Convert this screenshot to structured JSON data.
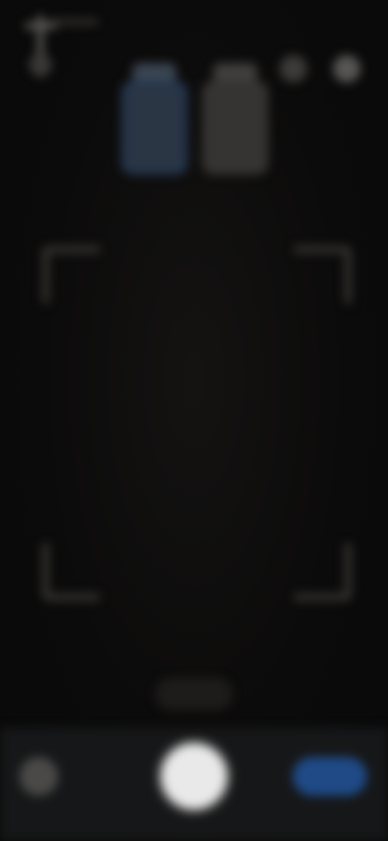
{
  "screen": {
    "type": "camera-scanner",
    "colors": {
      "background": "#0b0b0b",
      "accent": "#1f4a86",
      "active_mode": "#2b3644",
      "idle_mode": "#353432",
      "shutter": "#e9e9e9",
      "frame_corners": "#33322f",
      "bottom_bar": "#161718"
    }
  },
  "top_bar": {
    "left_icon": "settings-icon",
    "right_icons": [
      "flash-icon",
      "more-icon"
    ]
  },
  "modes": [
    {
      "icon": "scan-mode-icon",
      "state": "active"
    },
    {
      "icon": "document-mode-icon",
      "state": "idle"
    }
  ],
  "scan_frame": {
    "corners": [
      "top-left",
      "top-right",
      "bottom-left",
      "bottom-right"
    ]
  },
  "zoom": {
    "label": ""
  },
  "bottom_bar": {
    "gallery_icon": "gallery-icon",
    "shutter_icon": "shutter-button",
    "switch_icon": "camera-switch-icon"
  }
}
